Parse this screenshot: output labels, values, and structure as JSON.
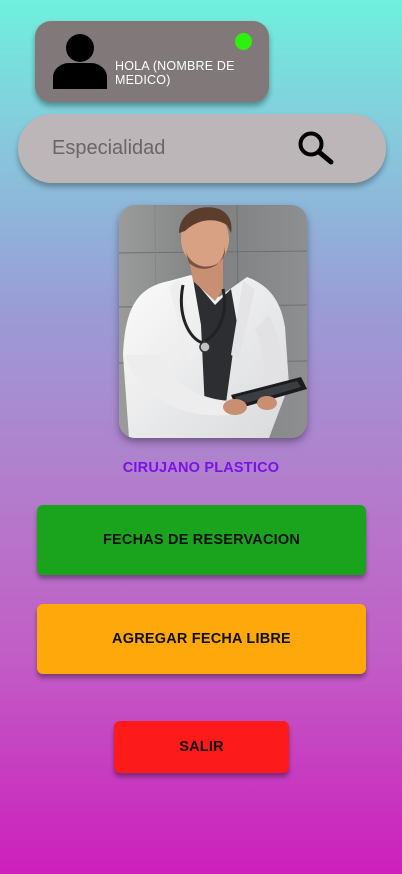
{
  "profile": {
    "greeting": "HOLA (NOMBRE DE MEDICO)",
    "status_color": "#2df00e",
    "avatar_icon": "user-silhouette-icon"
  },
  "search": {
    "placeholder": "Especialidad",
    "icon": "search-icon"
  },
  "doctor": {
    "photo": "doctor-photo",
    "specialty": "CIRUJANO PLASTICO"
  },
  "actions": {
    "reservations_label": "FECHAS DE RESERVACION",
    "add_free_date_label": "AGREGAR FECHA LIBRE",
    "exit_label": "SALIR"
  },
  "colors": {
    "reservations": "#1aa31c",
    "add_free_date": "#ffa80b",
    "exit": "#fc1a1a",
    "specialty_text": "#7a12e6"
  }
}
